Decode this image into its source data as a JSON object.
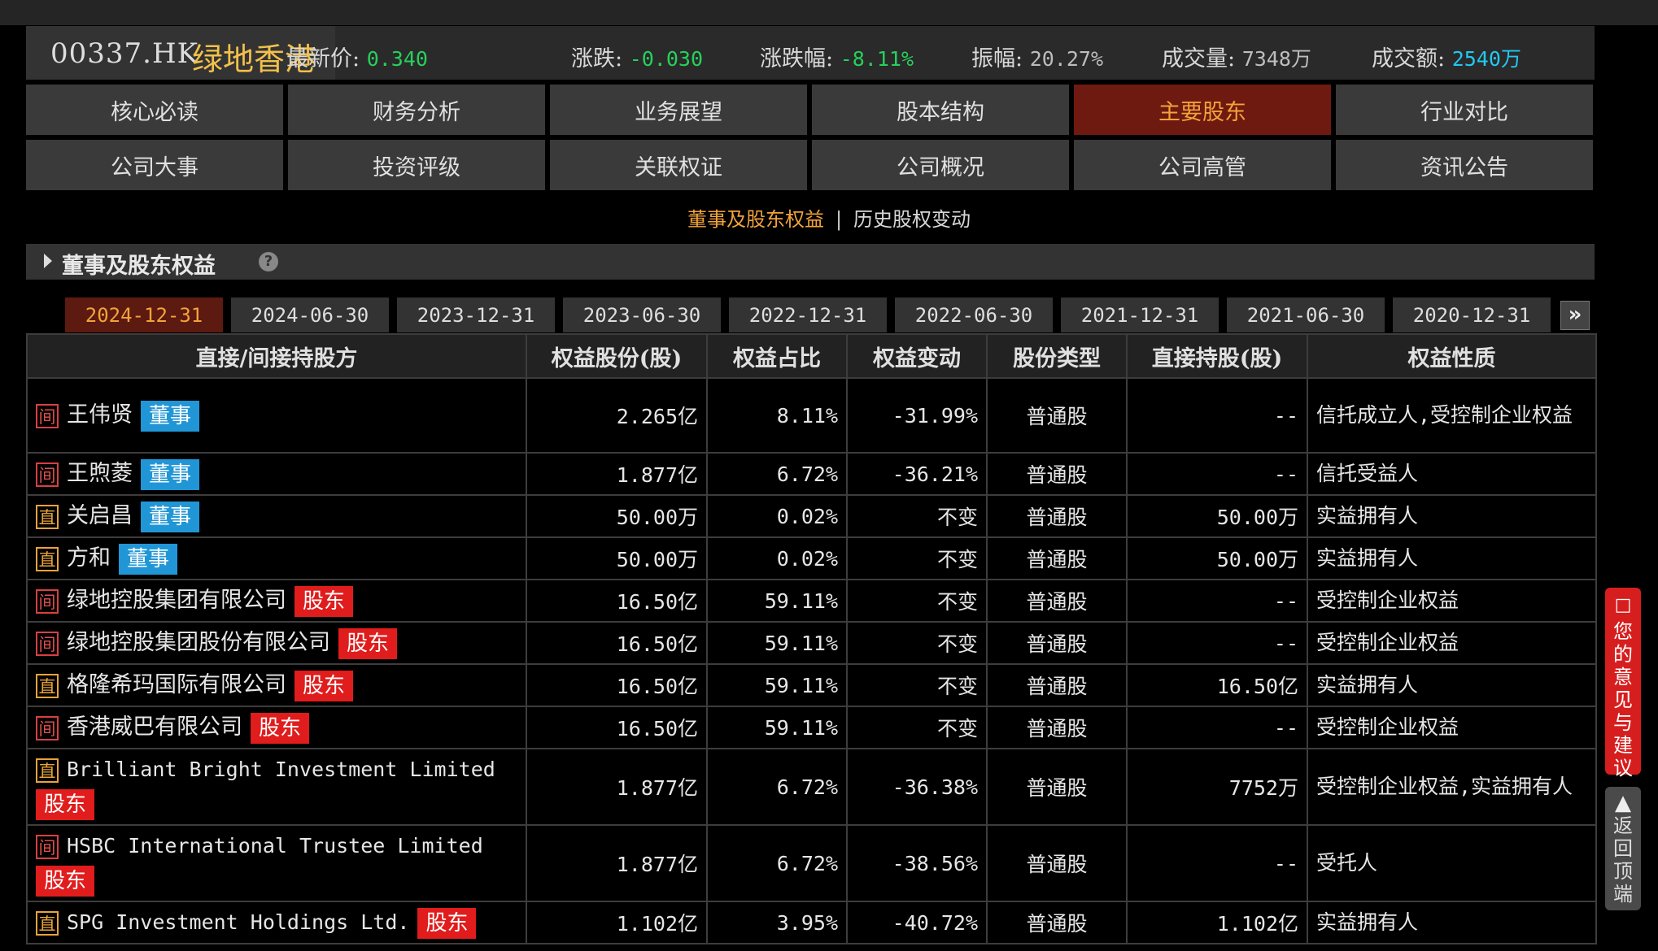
{
  "quote": {
    "code": "00337.HK",
    "name": "绿地香港",
    "latest_label": "最新价:",
    "latest_value": "0.340",
    "change_label": "涨跌:",
    "change_value": "-0.030",
    "pct_label": "涨跌幅:",
    "pct_value": "-8.11%",
    "amp_label": "振幅:",
    "amp_value": "20.27%",
    "vol_label": "成交量:",
    "vol_value": "7348万",
    "amt_label": "成交额:",
    "amt_value": "2540万"
  },
  "nav": [
    {
      "label": "核心必读"
    },
    {
      "label": "财务分析"
    },
    {
      "label": "业务展望"
    },
    {
      "label": "股本结构"
    },
    {
      "label": "主要股东"
    },
    {
      "label": "行业对比"
    },
    {
      "label": "公司大事"
    },
    {
      "label": "投资评级"
    },
    {
      "label": "关联权证"
    },
    {
      "label": "公司概况"
    },
    {
      "label": "公司高管"
    },
    {
      "label": "资讯公告"
    }
  ],
  "nav_active": "主要股东",
  "subnav": {
    "active": "董事及股东权益",
    "sep": "|",
    "other": "历史股权变动"
  },
  "section": {
    "title": "董事及股东权益",
    "help": "?"
  },
  "date_tabs": [
    "2024-12-31",
    "2024-06-30",
    "2023-12-31",
    "2023-06-30",
    "2022-12-31",
    "2022-06-30",
    "2021-12-31",
    "2021-06-30",
    "2020-12-31"
  ],
  "date_next": "»",
  "table": {
    "headers": [
      "直接/间接持股方",
      "权益股份(股)",
      "权益占比",
      "权益变动",
      "股份类型",
      "直接持股(股)",
      "权益性质"
    ],
    "rows": [
      {
        "flag": "间",
        "name": "王伟贤",
        "badge": "董事",
        "shares": "2.265亿",
        "ratio": "8.11%",
        "change": "-31.99%",
        "type": "普通股",
        "direct": "--",
        "nature": "信托成立人,受控制企业权益"
      },
      {
        "flag": "间",
        "name": "王煦菱",
        "badge": "董事",
        "shares": "1.877亿",
        "ratio": "6.72%",
        "change": "-36.21%",
        "type": "普通股",
        "direct": "--",
        "nature": "信托受益人"
      },
      {
        "flag": "直",
        "name": "关启昌",
        "badge": "董事",
        "shares": "50.00万",
        "ratio": "0.02%",
        "change": "不变",
        "type": "普通股",
        "direct": "50.00万",
        "nature": "实益拥有人"
      },
      {
        "flag": "直",
        "name": "方和",
        "badge": "董事",
        "shares": "50.00万",
        "ratio": "0.02%",
        "change": "不变",
        "type": "普通股",
        "direct": "50.00万",
        "nature": "实益拥有人"
      },
      {
        "flag": "间",
        "name": "绿地控股集团有限公司",
        "badge": "股东",
        "shares": "16.50亿",
        "ratio": "59.11%",
        "change": "不变",
        "type": "普通股",
        "direct": "--",
        "nature": "受控制企业权益"
      },
      {
        "flag": "间",
        "name": "绿地控股集团股份有限公司",
        "badge": "股东",
        "shares": "16.50亿",
        "ratio": "59.11%",
        "change": "不变",
        "type": "普通股",
        "direct": "--",
        "nature": "受控制企业权益"
      },
      {
        "flag": "直",
        "name": "格隆希玛国际有限公司",
        "badge": "股东",
        "shares": "16.50亿",
        "ratio": "59.11%",
        "change": "不变",
        "type": "普通股",
        "direct": "16.50亿",
        "nature": "实益拥有人"
      },
      {
        "flag": "间",
        "name": "香港威巴有限公司",
        "badge": "股东",
        "shares": "16.50亿",
        "ratio": "59.11%",
        "change": "不变",
        "type": "普通股",
        "direct": "--",
        "nature": "受控制企业权益"
      },
      {
        "flag": "直",
        "name": "Brilliant Bright Investment Limited",
        "badge": "股东",
        "shares": "1.877亿",
        "ratio": "6.72%",
        "change": "-36.38%",
        "type": "普通股",
        "direct": "7752万",
        "nature": "受控制企业权益,实益拥有人"
      },
      {
        "flag": "间",
        "name": "HSBC International Trustee Limited",
        "badge": "股东",
        "shares": "1.877亿",
        "ratio": "6.72%",
        "change": "-38.56%",
        "type": "普通股",
        "direct": "--",
        "nature": "受托人"
      },
      {
        "flag": "直",
        "name": "SPG Investment Holdings Ltd.",
        "badge": "股东",
        "shares": "1.102亿",
        "ratio": "3.95%",
        "change": "-40.72%",
        "type": "普通股",
        "direct": "1.102亿",
        "nature": "实益拥有人"
      }
    ]
  },
  "side": {
    "feedback": "您的意见与建议",
    "back_top": "返回顶端"
  },
  "colors": {
    "accent": "#f3a33a",
    "up_down_green": "#26d15b",
    "active_bg": "#6e1a10",
    "director_badge": "#2196d6",
    "holder_badge": "#e01c1c"
  }
}
